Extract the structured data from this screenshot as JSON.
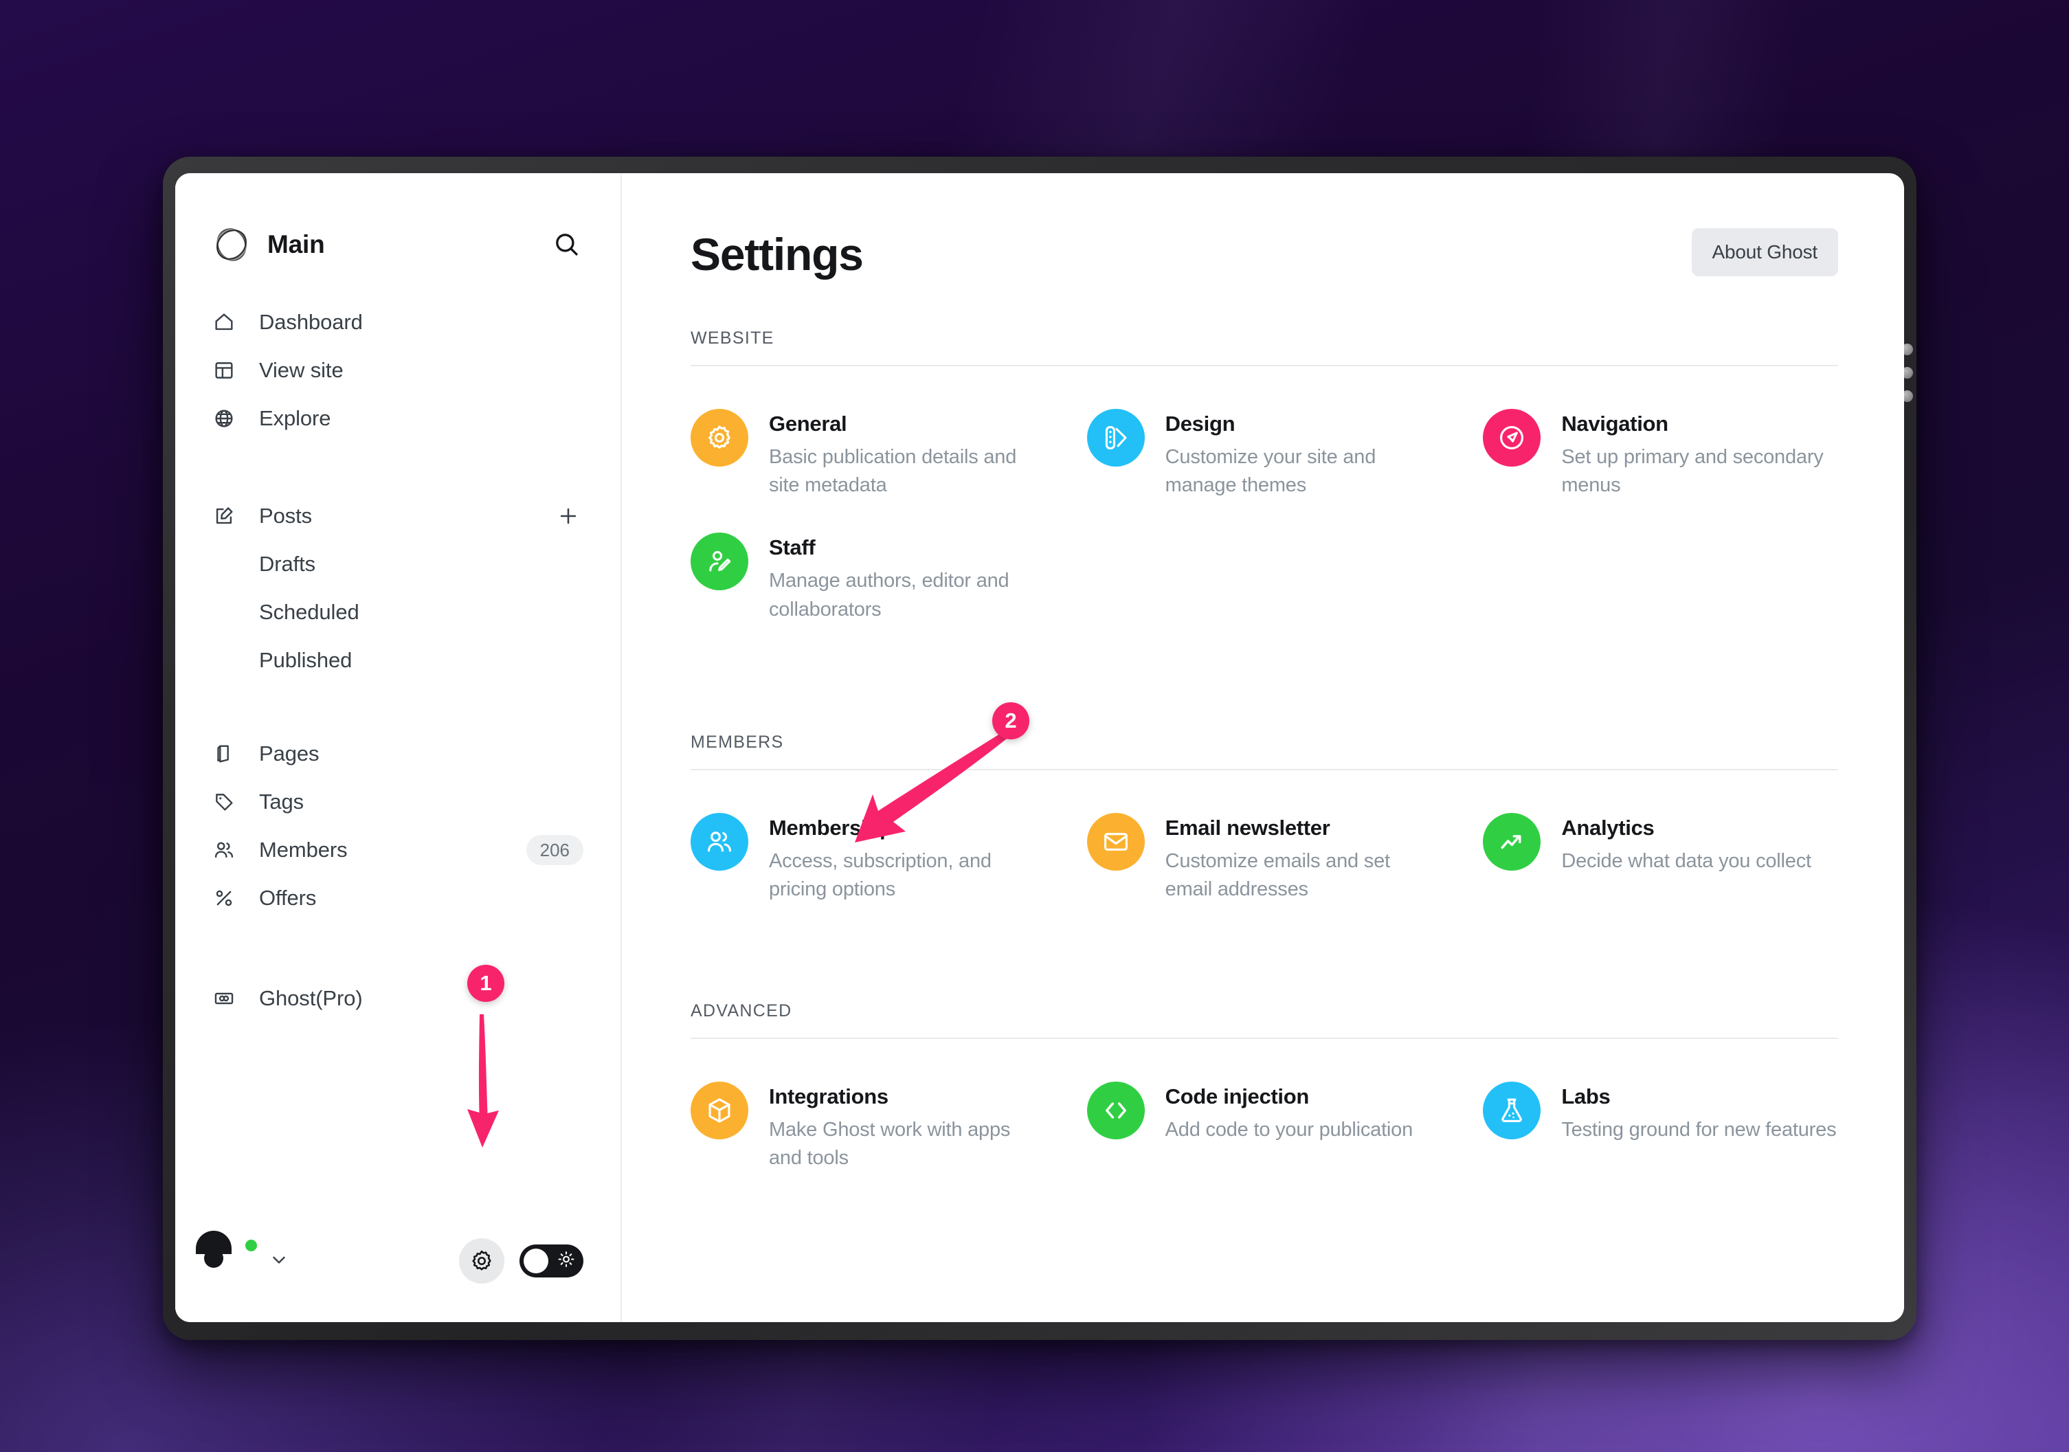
{
  "theme": {
    "accent_pink": "#f8246b",
    "badge_gray": "#eef0f2",
    "text_dark": "#15171a",
    "text_muted": "#8b949d"
  },
  "sidebar": {
    "site_name": "Main",
    "search_icon": "search-icon",
    "groups": [
      {
        "items": [
          {
            "label": "Dashboard",
            "icon": "home-icon"
          },
          {
            "label": "View site",
            "icon": "layout-icon"
          },
          {
            "label": "Explore",
            "icon": "globe-icon"
          }
        ]
      },
      {
        "items": [
          {
            "label": "Posts",
            "icon": "edit-icon",
            "action_icon": "plus-icon"
          },
          {
            "label": "Drafts",
            "icon": "",
            "sub": true
          },
          {
            "label": "Scheduled",
            "icon": "",
            "sub": true
          },
          {
            "label": "Published",
            "icon": "",
            "sub": true
          }
        ]
      },
      {
        "items": [
          {
            "label": "Pages",
            "icon": "pages-icon"
          },
          {
            "label": "Tags",
            "icon": "tag-icon"
          },
          {
            "label": "Members",
            "icon": "members-icon",
            "badge": "206"
          },
          {
            "label": "Offers",
            "icon": "percent-icon"
          }
        ]
      },
      {
        "items": [
          {
            "label": "Ghost(Pro)",
            "icon": "ghost-pro-icon"
          }
        ]
      }
    ],
    "footer": {
      "avatar": "user-avatar",
      "status": "online",
      "caret_icon": "chevron-down-icon",
      "settings_icon": "gear-icon",
      "theme_toggle_icon": "sun-icon",
      "theme_toggle_state": "off"
    }
  },
  "header": {
    "title": "Settings",
    "about_button": "About Ghost"
  },
  "sections": [
    {
      "title": "WEBSITE",
      "cards": [
        {
          "title": "General",
          "desc": "Basic publication details and site metadata",
          "icon": "gear-icon",
          "color": "#fbb12f"
        },
        {
          "title": "Design",
          "desc": "Customize your site and manage themes",
          "icon": "palette-icon",
          "color": "#22c0f7"
        },
        {
          "title": "Navigation",
          "desc": "Set up primary and secondary menus",
          "icon": "compass-icon",
          "color": "#f8246b"
        },
        {
          "title": "Staff",
          "desc": "Manage authors, editor and collaborators",
          "icon": "user-edit-icon",
          "color": "#30cf43"
        }
      ]
    },
    {
      "title": "MEMBERS",
      "cards": [
        {
          "title": "Membership",
          "desc": "Access, subscription, and pricing options",
          "icon": "members-icon",
          "color": "#22c0f7"
        },
        {
          "title": "Email newsletter",
          "desc": "Customize emails and set email addresses",
          "icon": "envelope-icon",
          "color": "#fbb12f"
        },
        {
          "title": "Analytics",
          "desc": "Decide what data you collect",
          "icon": "trend-up-icon",
          "color": "#30cf43"
        }
      ]
    },
    {
      "title": "ADVANCED",
      "cards": [
        {
          "title": "Integrations",
          "desc": "Make Ghost work with apps and tools",
          "icon": "box-icon",
          "color": "#fbb12f"
        },
        {
          "title": "Code injection",
          "desc": "Add code to your publication",
          "icon": "code-icon",
          "color": "#30cf43"
        },
        {
          "title": "Labs",
          "desc": "Testing ground for new features",
          "icon": "flask-icon",
          "color": "#22c0f7"
        }
      ]
    }
  ],
  "annotations": [
    {
      "number": "1",
      "target": "settings-gear-button",
      "direction": "down"
    },
    {
      "number": "2",
      "target": "membership-card",
      "direction": "down-left"
    }
  ]
}
